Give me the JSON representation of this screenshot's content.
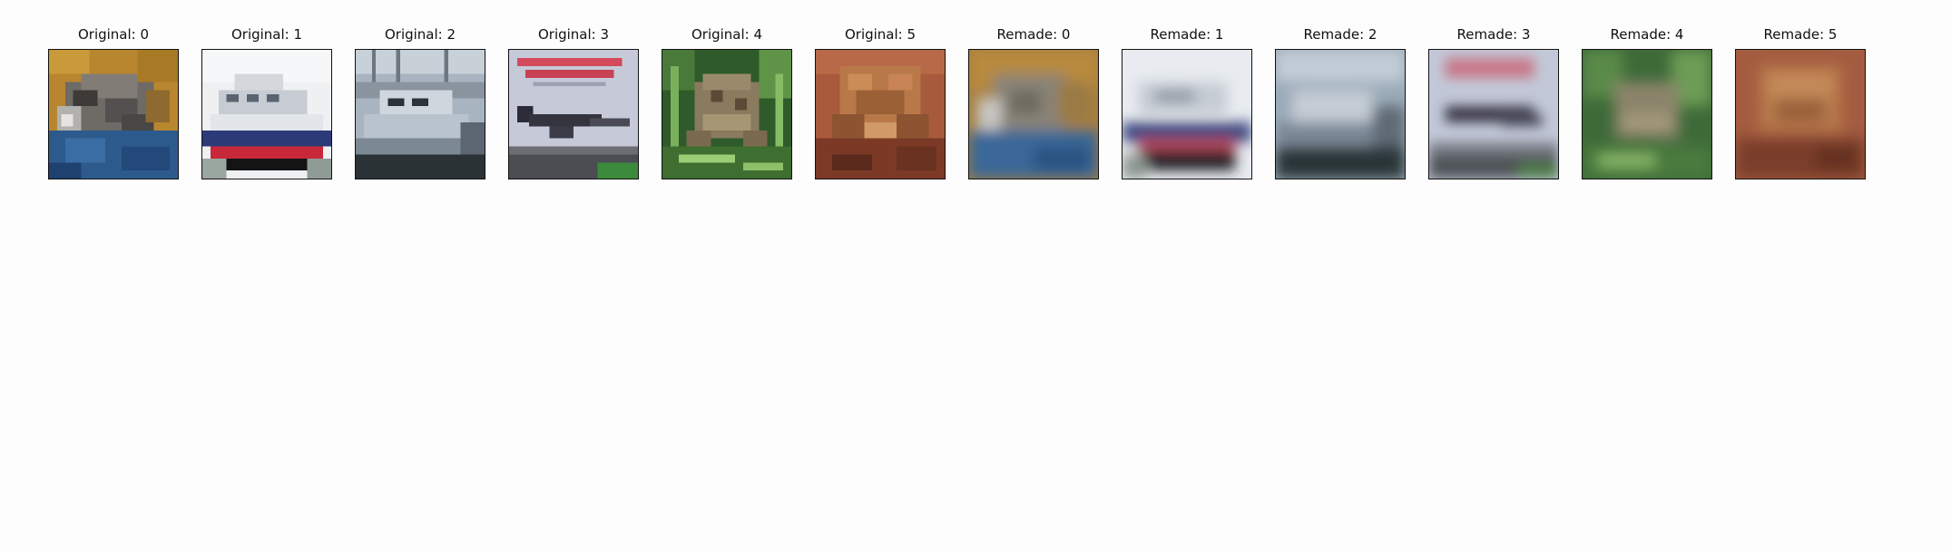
{
  "panels": [
    {
      "title": "Original: 0",
      "subject": "cat",
      "style": "pixelated"
    },
    {
      "title": "Original: 1",
      "subject": "ship",
      "style": "pixelated"
    },
    {
      "title": "Original: 2",
      "subject": "ship",
      "style": "pixelated"
    },
    {
      "title": "Original: 3",
      "subject": "airplane",
      "style": "pixelated"
    },
    {
      "title": "Original: 4",
      "subject": "frog",
      "style": "pixelated"
    },
    {
      "title": "Original: 5",
      "subject": "frog",
      "style": "pixelated"
    },
    {
      "title": "Remade: 0",
      "subject": "cat",
      "style": "blurred"
    },
    {
      "title": "Remade: 1",
      "subject": "ship",
      "style": "blurred"
    },
    {
      "title": "Remade: 2",
      "subject": "ship",
      "style": "blurred"
    },
    {
      "title": "Remade: 3",
      "subject": "airplane",
      "style": "blurred"
    },
    {
      "title": "Remade: 4",
      "subject": "frog",
      "style": "blurred"
    },
    {
      "title": "Remade: 5",
      "subject": "frog",
      "style": "blurred"
    }
  ]
}
